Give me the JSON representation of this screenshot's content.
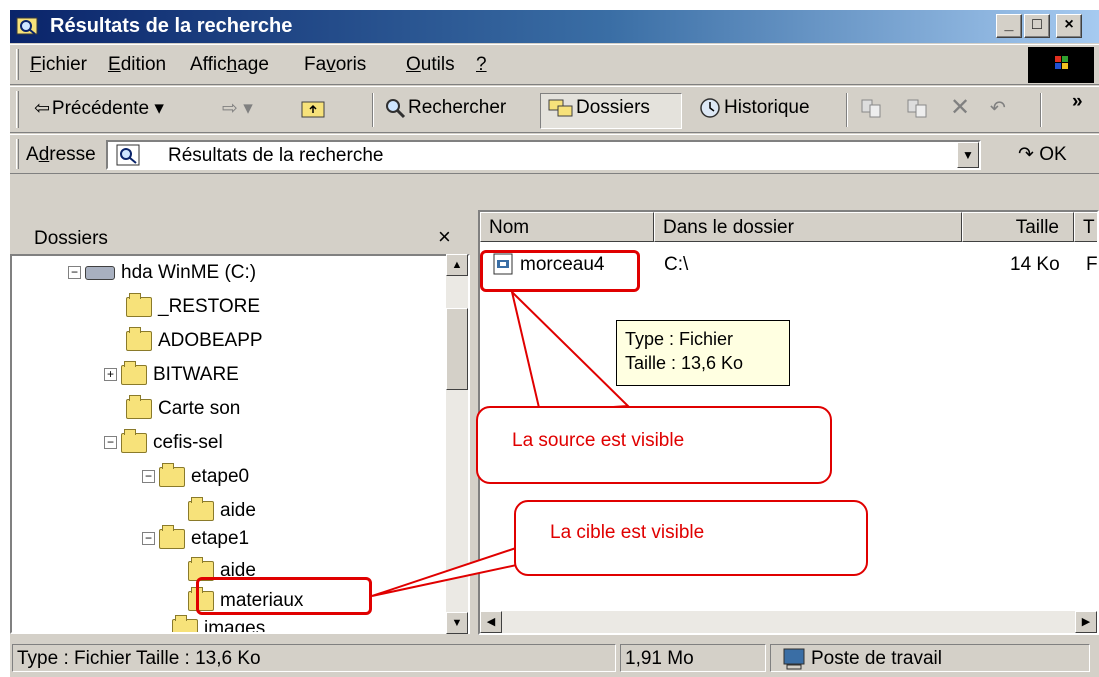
{
  "window": {
    "title": "Résultats de la recherche"
  },
  "menu": {
    "items": [
      {
        "pre": "",
        "ul": "F",
        "post": "ichier"
      },
      {
        "pre": "",
        "ul": "E",
        "post": "dition"
      },
      {
        "pre": "Affic",
        "ul": "h",
        "post": "age"
      },
      {
        "pre": "Fa",
        "ul": "v",
        "post": "oris"
      },
      {
        "pre": "",
        "ul": "O",
        "post": "utils"
      },
      {
        "pre": "",
        "ul": "?",
        "post": ""
      }
    ]
  },
  "toolbar": {
    "back_label": "Précédente",
    "search_label": "Rechercher",
    "folders_label": "Dossiers",
    "history_label": "Historique",
    "more_label": "»"
  },
  "address": {
    "label_pre": "A",
    "label_ul": "d",
    "label_post": "resse",
    "value": "Résultats de la recherche",
    "ok_label": "OK"
  },
  "folders_pane": {
    "header": "Dossiers",
    "close": "×",
    "tree": [
      {
        "label": "hda WinME (C:)",
        "type": "drive",
        "expander": "−"
      },
      {
        "label": "_RESTORE",
        "type": "folder",
        "expander": ""
      },
      {
        "label": "ADOBEAPP",
        "type": "folder",
        "expander": ""
      },
      {
        "label": "BITWARE",
        "type": "folder",
        "expander": "+"
      },
      {
        "label": "Carte son",
        "type": "folder",
        "expander": ""
      },
      {
        "label": "cefis-sel",
        "type": "folder",
        "expander": "−"
      },
      {
        "label": "etape0",
        "type": "folder",
        "expander": "−"
      },
      {
        "label": "aide",
        "type": "folder",
        "expander": ""
      },
      {
        "label": "etape1",
        "type": "folder",
        "expander": "−"
      },
      {
        "label": "aide",
        "type": "folder",
        "expander": ""
      },
      {
        "label": "materiaux",
        "type": "folder",
        "expander": ""
      },
      {
        "label": "images",
        "type": "folder",
        "expander": ""
      }
    ]
  },
  "results": {
    "columns": [
      "Nom",
      "Dans le dossier",
      "Taille",
      "T"
    ],
    "rows": [
      {
        "name": "morceau4",
        "folder": "C:\\",
        "size": "14 Ko",
        "type": "F"
      }
    ]
  },
  "tooltip": {
    "line1": "Type : Fichier",
    "line2": "Taille  : 13,6 Ko"
  },
  "annotations": {
    "source": "La source est visible",
    "target": "La cible est visible"
  },
  "status": {
    "info": "Type : Fichier Taille  : 13,6 Ko",
    "size": "1,91 Mo",
    "zone": "Poste de travail"
  },
  "colors": {
    "annotation_red": "#e00000",
    "title_gradient_start": "#0a246a",
    "title_gradient_end": "#a6caf0",
    "tooltip_bg": "#ffffe1"
  }
}
